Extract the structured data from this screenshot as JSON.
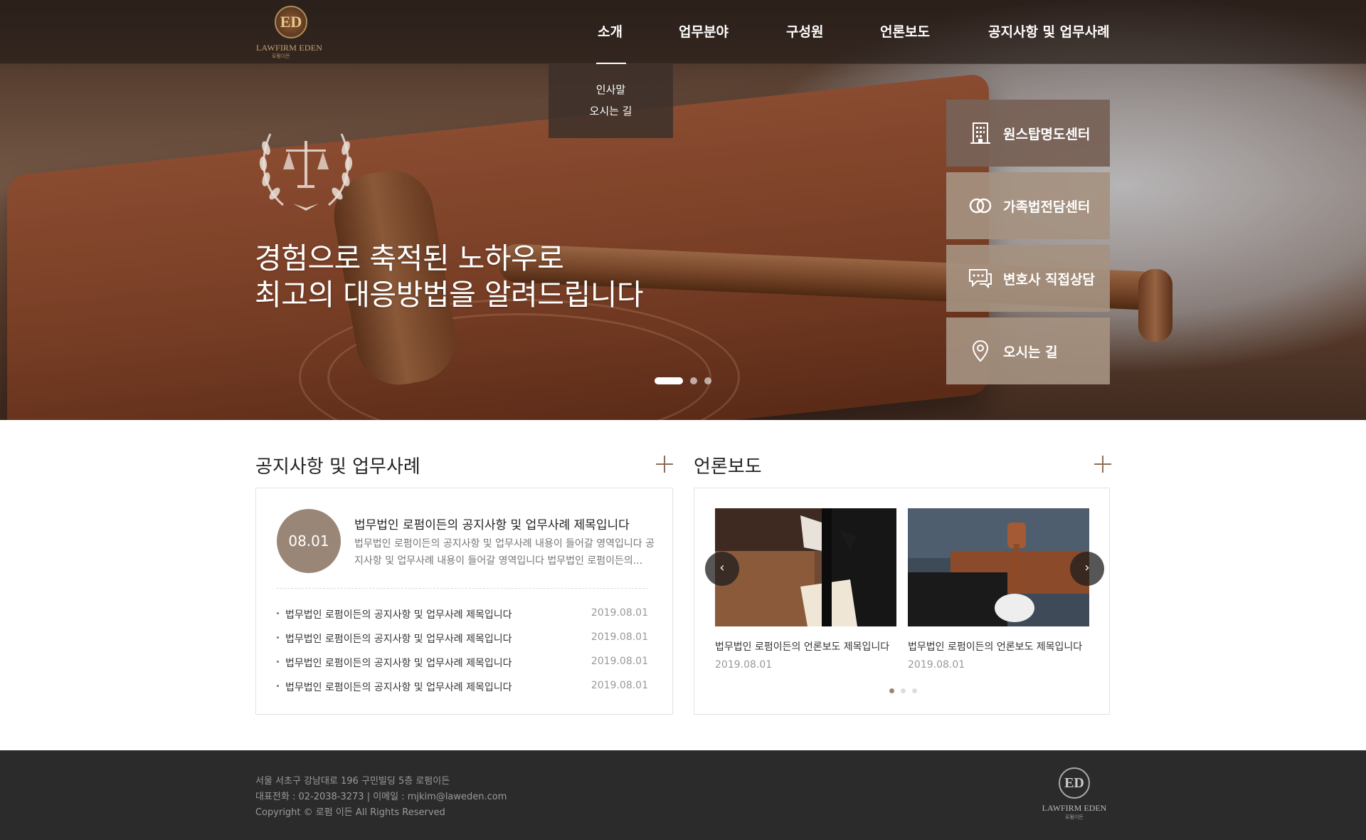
{
  "brand": {
    "logo_text": "LAWFIRM EDEN",
    "logo_sub": "로펌이든",
    "mono": "ED"
  },
  "nav": {
    "items": [
      "소개",
      "업무분야",
      "구성원",
      "언론보도",
      "공지사항 및 업무사례"
    ],
    "active_index": 0,
    "dropdown": [
      "인사말",
      "오시는 길"
    ]
  },
  "hero": {
    "line1": "경험으로 축적된 노하우로",
    "line2": "최고의 대응방법을 알려드립니다",
    "slide_count": 3,
    "active_slide": 0
  },
  "quick_links": [
    {
      "label": "원스탑명도센터",
      "icon": "building-icon"
    },
    {
      "label": "가족법전담센터",
      "icon": "rings-icon"
    },
    {
      "label": "변호사 직접상담",
      "icon": "chat-icon"
    },
    {
      "label": "오시는 길",
      "icon": "location-pin-icon"
    }
  ],
  "notice": {
    "title": "공지사항 및 업무사례",
    "featured": {
      "date": "08.01",
      "title": "법무법인 로펌이든의 공지사항 및 업무사례 제목입니다",
      "desc": "법무법인 로펌이든의 공지사항 및 업무사례 내용이 들어갈 영역입니다 공지사항 및 업무사례 내용이 들어갈 영역입니다 법무법인 로펌이든의..."
    },
    "items": [
      {
        "title": "법무법인 로펌이든의 공지사항 및 업무사례 제목입니다",
        "date": "2019.08.01"
      },
      {
        "title": "법무법인 로펌이든의 공지사항 및 업무사례 제목입니다",
        "date": "2019.08.01"
      },
      {
        "title": "법무법인 로펌이든의 공지사항 및 업무사례 제목입니다",
        "date": "2019.08.01"
      },
      {
        "title": "법무법인 로펌이든의 공지사항 및 업무사례 제목입니다",
        "date": "2019.08.01"
      }
    ]
  },
  "press": {
    "title": "언론보도",
    "cards": [
      {
        "title": "법무법인 로펌이든의 언론보도 제목입니다",
        "date": "2019.08.01"
      },
      {
        "title": "법무법인 로펌이든의 언론보도 제목입니다",
        "date": "2019.08.01"
      }
    ],
    "page_count": 3,
    "active_page": 0,
    "prev": "‹",
    "next": "›"
  },
  "footer": {
    "address": "서울 서초구 강남대로 196 구민빌딩 5층 로펌이든",
    "contact": "대표전화 : 02-2038-3273 | 이메일 : mjkim@laweden.com",
    "copyright": "Copyright © 로펌 이든 All Rights Reserved"
  },
  "colors": {
    "accent": "#9a8676",
    "header": "#2d221d",
    "footer": "#2b2b2b"
  }
}
